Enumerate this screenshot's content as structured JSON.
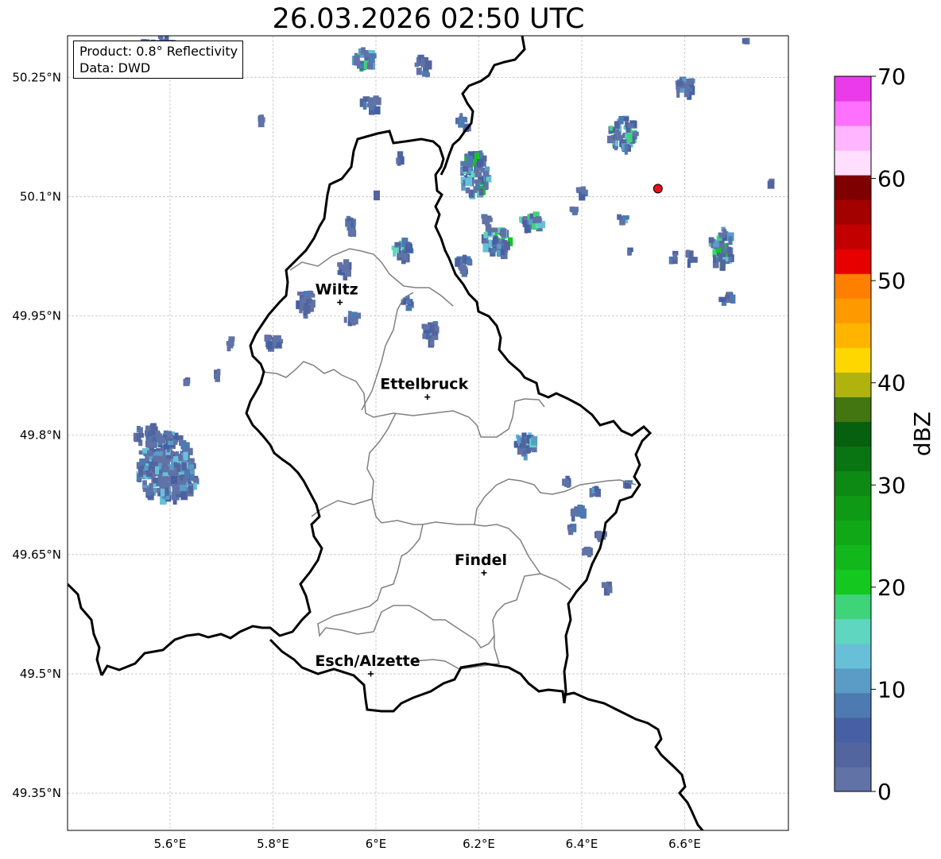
{
  "title": "26.03.2026 02:50 UTC",
  "info": {
    "product": "Product: 0.8° Reflectivity",
    "data": "Data: DWD"
  },
  "map": {
    "lon_range": [
      5.4,
      6.8
    ],
    "lat_range": [
      49.3,
      50.3
    ],
    "lat_ticks": [
      {
        "value": 50.25,
        "label": "50.25°N"
      },
      {
        "value": 50.1,
        "label": "50.1°N"
      },
      {
        "value": 49.95,
        "label": "49.95°N"
      },
      {
        "value": 49.8,
        "label": "49.8°N"
      },
      {
        "value": 49.65,
        "label": "49.65°N"
      },
      {
        "value": 49.5,
        "label": "49.5°N"
      },
      {
        "value": 49.35,
        "label": "49.35°N"
      }
    ],
    "lon_ticks": [
      {
        "value": 5.6,
        "label": "5.6°E"
      },
      {
        "value": 5.8,
        "label": "5.8°E"
      },
      {
        "value": 6.0,
        "label": "6°E"
      },
      {
        "value": 6.2,
        "label": "6.2°E"
      },
      {
        "value": 6.4,
        "label": "6.4°E"
      },
      {
        "value": 6.6,
        "label": "6.6°E"
      }
    ],
    "cities": [
      {
        "name": "Wiltz",
        "lon": 5.93,
        "lat": 49.967
      },
      {
        "name": "Ettelbruck",
        "lon": 6.1,
        "lat": 49.848
      },
      {
        "name": "Findel",
        "lon": 6.21,
        "lat": 49.627
      },
      {
        "name": "Esch/Alzette",
        "lon": 5.99,
        "lat": 49.5
      }
    ],
    "radar_site": {
      "lon": 6.548,
      "lat": 50.11,
      "color": "#e8101a"
    }
  },
  "colorbar": {
    "label": "dBZ",
    "min": 0,
    "max": 70,
    "ticks": [
      "0",
      "10",
      "20",
      "30",
      "40",
      "50",
      "60",
      "70"
    ],
    "colors": [
      "#6172a6",
      "#53659f",
      "#4660a3",
      "#4d7ab0",
      "#5b9cc6",
      "#67c0d8",
      "#5fd6c0",
      "#3fd37a",
      "#14c81f",
      "#12b81b",
      "#11a818",
      "#0f9a16",
      "#0c8a14",
      "#087412",
      "#075f10",
      "#437510",
      "#b0b20e",
      "#ffd700",
      "#ffb400",
      "#ff9900",
      "#ff7f00",
      "#e60000",
      "#c30000",
      "#a30000",
      "#7f0000",
      "#ffdeff",
      "#ffb5ff",
      "#ff70ff",
      "#ea3aea"
    ]
  }
}
